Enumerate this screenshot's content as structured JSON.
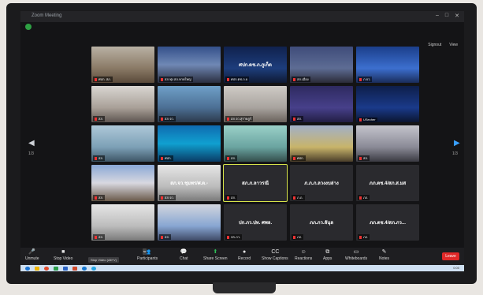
{
  "window": {
    "title": "Zoom Meeting"
  },
  "top_right": {
    "signout": "Signout",
    "view": "View"
  },
  "navigation": {
    "prev_page": "1/3",
    "next_page": "1/3"
  },
  "tiles": [
    {
      "name": "ศปก. สภ.",
      "cls": "v1",
      "big": ""
    },
    {
      "name": "สภ.ทุ่ง สภ.หาดใหญ่",
      "cls": "v2",
      "big": ""
    },
    {
      "name": "ศปก.ตช.ภ.6",
      "cls": "v3",
      "big": "ศปก.ตช.ภ.ภูเก็ต"
    },
    {
      "name": "สภ.เมือง",
      "cls": "v4",
      "big": ""
    },
    {
      "name": "ภ.จว.",
      "cls": "v5",
      "big": ""
    },
    {
      "name": "สภ.",
      "cls": "v6",
      "big": ""
    },
    {
      "name": "สภ.จว.",
      "cls": "v7",
      "big": ""
    },
    {
      "name": "สภ.จว.สุราษฎร์",
      "cls": "v8",
      "big": ""
    },
    {
      "name": "สภ.",
      "cls": "v9",
      "big": ""
    },
    {
      "name": "USecher",
      "cls": "v10",
      "big": ""
    },
    {
      "name": "สภ.",
      "cls": "v11",
      "big": ""
    },
    {
      "name": "ศปก.",
      "cls": "v12",
      "big": ""
    },
    {
      "name": "สภ.",
      "cls": "v13",
      "big": ""
    },
    {
      "name": "ศปก.",
      "cls": "v14",
      "big": ""
    },
    {
      "name": "สภ.",
      "cls": "v15",
      "big": ""
    },
    {
      "name": "สภ.",
      "cls": "v16",
      "big": ""
    },
    {
      "name": "สภ.จว.",
      "cls": "v17",
      "big": "สภ.จว.ชุมพร/ศ.ต.-"
    },
    {
      "name": "สภ.",
      "cls": "v0",
      "big": "สภ.ภ.ลาวรณี"
    },
    {
      "name": "ภ.ภ.",
      "cls": "v0",
      "big": "ภ.ภ.ภ.ลวงงบล่าง"
    },
    {
      "name": "ภภ.",
      "cls": "v0",
      "big": "ภภ.ตช.4/สภ.ส.มส"
    },
    {
      "name": "สภ.",
      "cls": "v17",
      "big": ""
    },
    {
      "name": "สภ.",
      "cls": "v18",
      "big": ""
    },
    {
      "name": "ปก.ภว.",
      "cls": "v0",
      "big": "ปก.ภว.ปท. ศพล."
    },
    {
      "name": "ภภ.",
      "cls": "v0",
      "big": "ภภ.ภว.ลันุล"
    },
    {
      "name": "ภภ.",
      "cls": "v0",
      "big": "ภภ.ตช.4/สภ.ภว..."
    }
  ],
  "toolbar": {
    "unmute": "Unmute",
    "stop_video": "Stop Video",
    "stop_video_tooltip": "Stop Video (Alt+V)",
    "participants": "Participants",
    "participants_count": "50",
    "chat": "Chat",
    "share_screen": "Share Screen",
    "record": "Record",
    "show_captions": "Show Captions",
    "reactions": "Reactions",
    "apps": "Apps",
    "whiteboards": "Whiteboards",
    "notes": "Notes",
    "leave": "Leave"
  },
  "taskbar": {
    "clock": "0:00"
  },
  "colors": {
    "leave": "#e02828",
    "share_green": "#2fbf57",
    "active_border": "#d7e44a"
  }
}
